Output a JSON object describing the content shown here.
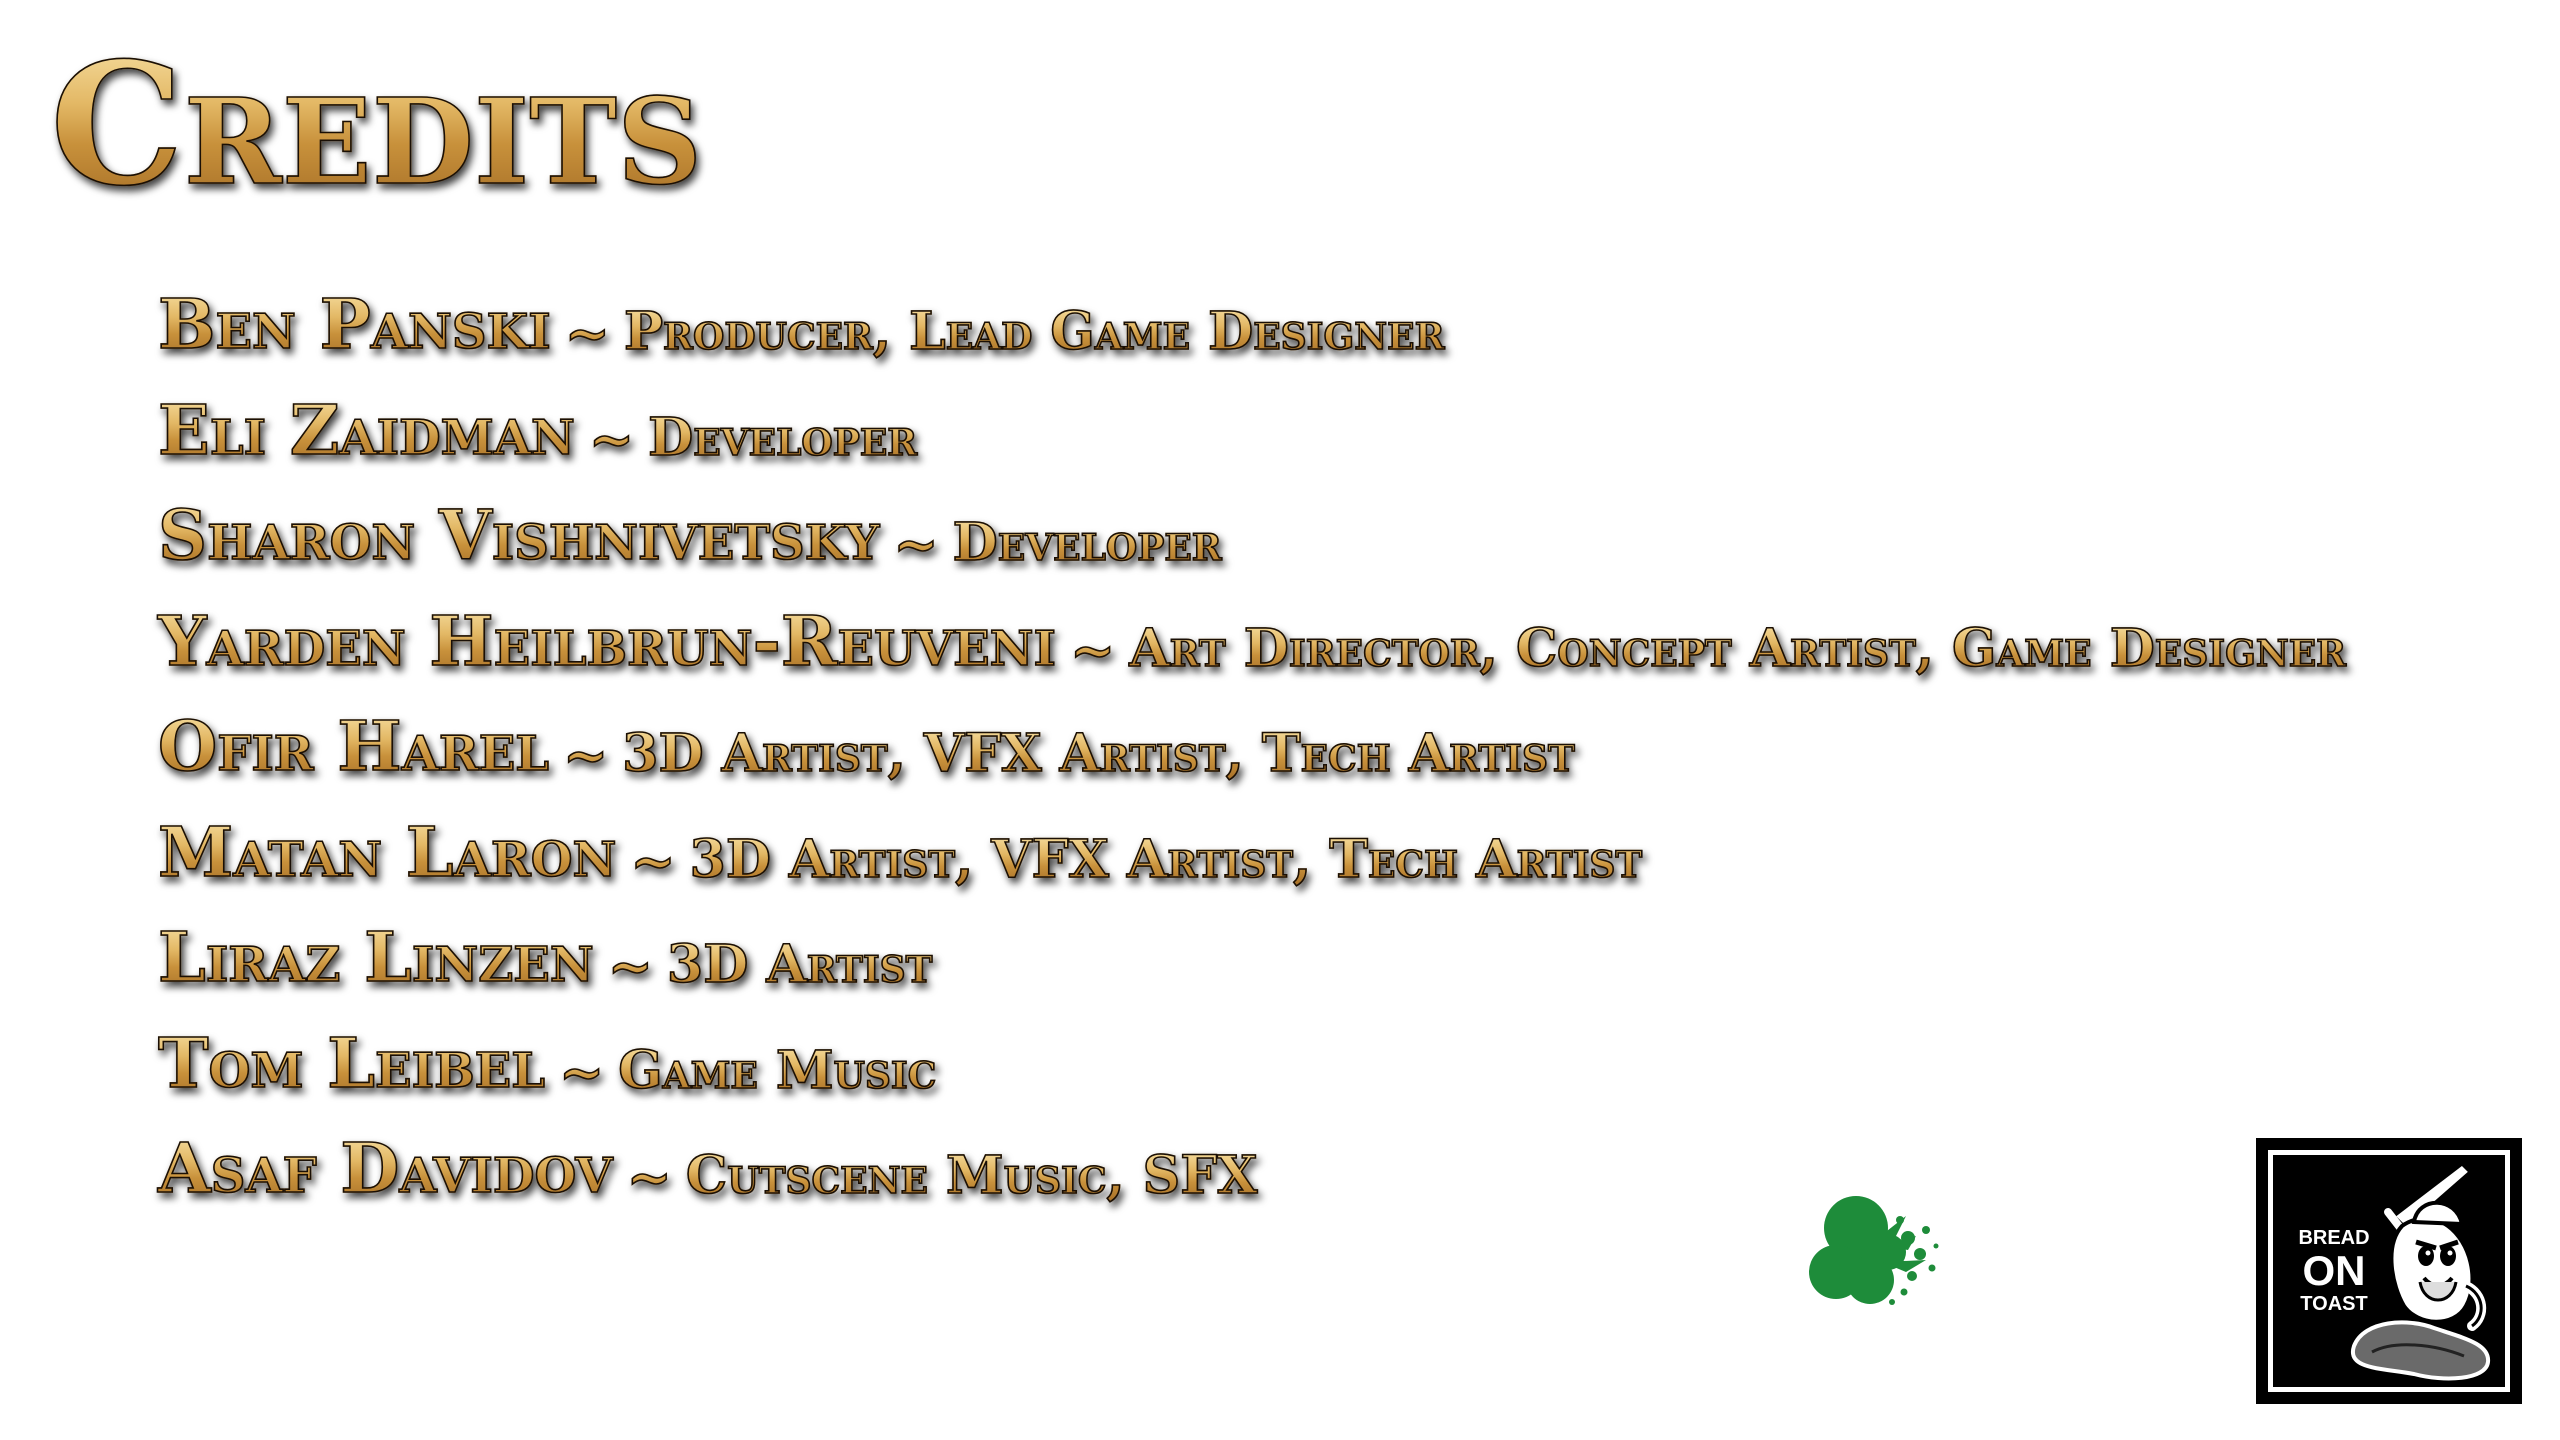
{
  "title": "Credits",
  "separator": "~",
  "credits": [
    {
      "name": "Ben Panski",
      "role": "Producer, Lead Game Designer"
    },
    {
      "name": "Eli Zaidman",
      "role": "Developer"
    },
    {
      "name": "Sharon Vishnivetsky",
      "role": "Developer"
    },
    {
      "name": "Yarden Heilbrun-Reuveni",
      "role": "Art Director, Concept Artist, Game Designer"
    },
    {
      "name": "Ofir Harel",
      "role": "3D Artist, VFX Artist, Tech Artist"
    },
    {
      "name": "Matan Laron",
      "role": "3D Artist, VFX Artist, Tech Artist"
    },
    {
      "name": "Liraz Linzen",
      "role": "3D Artist"
    },
    {
      "name": "Tom Leibel",
      "role": "Game Music"
    },
    {
      "name": "Asaf Davidov",
      "role": "Cutscene Music, SFX"
    }
  ],
  "studio_logo": {
    "line1": "BREAD",
    "line2": "ON",
    "line3": "TOAST",
    "icon": "bread-knight-icon"
  },
  "splat": {
    "icon": "green-paint-splat-icon",
    "color": "#1e8c3a"
  },
  "colors": {
    "gold_light": "#f6dea0",
    "gold_mid": "#e3b865",
    "gold_dark": "#a66f27",
    "outline": "#1a0f05",
    "background": "#ffffff"
  }
}
